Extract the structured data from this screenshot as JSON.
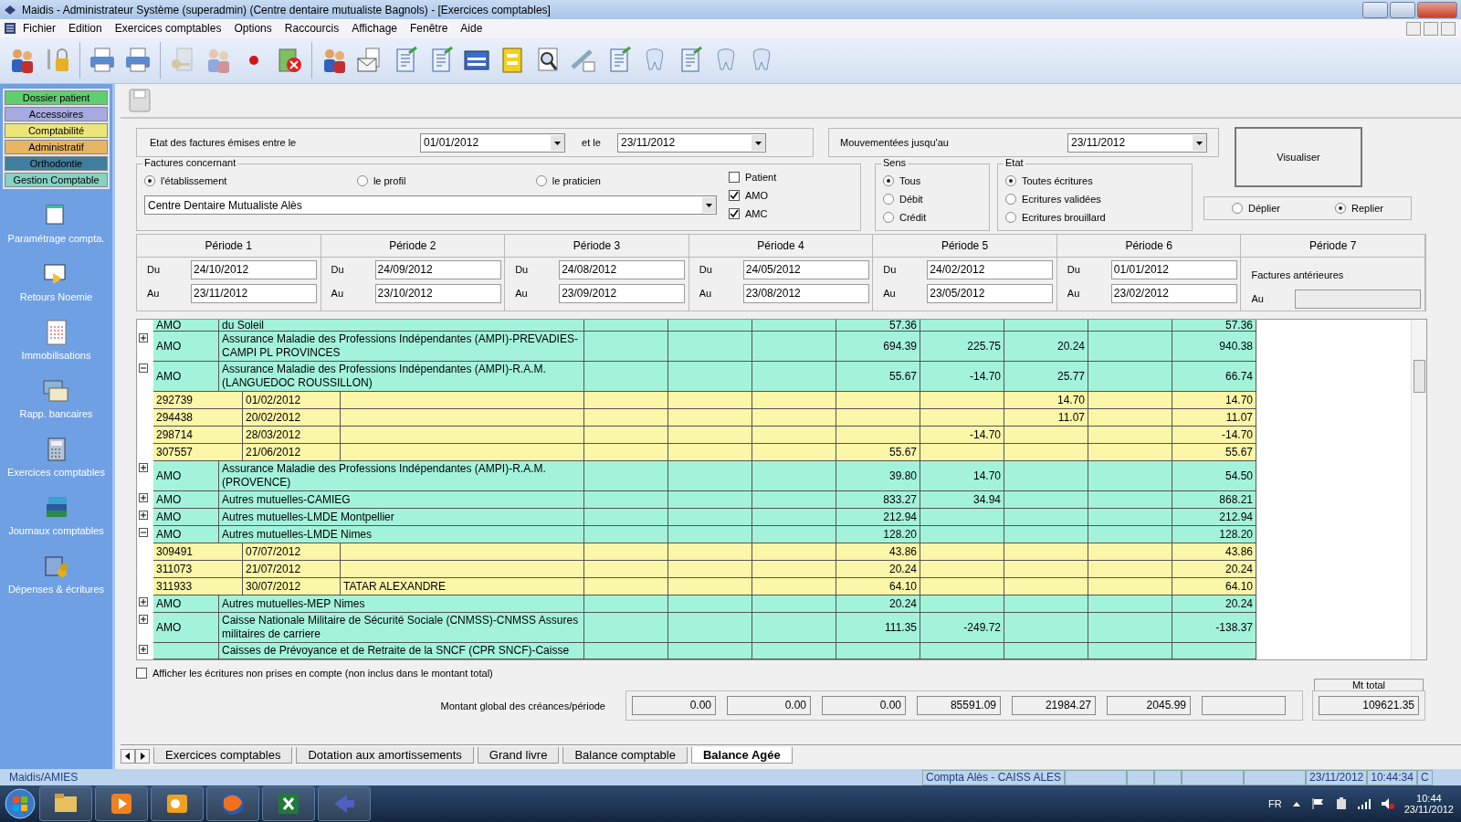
{
  "window": {
    "title": "Maidis - Administrateur Système (superadmin) (Centre dentaire mutualiste Bagnols) - [Exercices comptables]"
  },
  "menu": [
    "Fichier",
    "Edition",
    "Exercices comptables",
    "Options",
    "Raccourcis",
    "Affichage",
    "Fenêtre",
    "Aide"
  ],
  "toolbar": [
    {
      "disabled": false
    },
    {
      "disabled": false
    },
    {
      "disabled": false
    },
    {
      "disabled": false
    },
    {
      "disabled": true
    },
    {
      "disabled": true
    },
    {
      "disabled": false
    },
    {
      "disabled": false
    },
    {
      "disabled": false
    },
    {
      "disabled": false
    },
    {
      "disabled": false
    },
    {
      "disabled": false
    },
    {
      "disabled": false
    },
    {
      "disabled": false
    },
    {
      "disabled": false
    },
    {
      "disabled": false
    },
    {
      "disabled": false
    },
    {
      "disabled": false
    },
    {
      "disabled": false
    },
    {
      "disabled": false
    },
    {
      "disabled": false
    }
  ],
  "sidebar": {
    "categories": [
      {
        "label": "Dossier patient",
        "color": "#5fcf6f"
      },
      {
        "label": "Accessoires",
        "color": "#a7a9e3"
      },
      {
        "label": "Comptabilité",
        "color": "#ece57a"
      },
      {
        "label": "Administratif",
        "color": "#e8b565"
      },
      {
        "label": "Orthodontie",
        "color": "#3f7e9c"
      },
      {
        "label": "Gestion Comptable",
        "color": "#86d1c3"
      }
    ],
    "items": [
      "Paramétrage compta.",
      "Retours Noemie",
      "Immobilisations",
      "Rapp. bancaires",
      "Exercices comptables",
      "Journaux comptables",
      "Dépenses & écritures"
    ]
  },
  "filters": {
    "date_range": {
      "label": "Etat des factures émises entre le",
      "from": "01/01/2012",
      "to_label": "et le",
      "to": "23/11/2012"
    },
    "moved_until": {
      "label": "Mouvementées jusqu'au",
      "value": "23/11/2012"
    },
    "view_button": "Visualiser",
    "invoices_for": {
      "title": "Factures concernant",
      "options": [
        {
          "label": "l'établissement",
          "selected": true
        },
        {
          "label": "le profil",
          "selected": false
        },
        {
          "label": "le praticien",
          "selected": false
        }
      ],
      "value": "Centre Dentaire Mutualiste Alès"
    },
    "payers": [
      {
        "label": "Patient",
        "checked": false
      },
      {
        "label": "AMO",
        "checked": true
      },
      {
        "label": "AMC",
        "checked": true
      }
    ],
    "direction": {
      "title": "Sens",
      "options": [
        {
          "label": "Tous",
          "selected": true
        },
        {
          "label": "Débit",
          "selected": false
        },
        {
          "label": "Crédit",
          "selected": false
        }
      ]
    },
    "state": {
      "title": "Etat",
      "options": [
        {
          "label": "Toutes écritures",
          "selected": true
        },
        {
          "label": "Ecritures validées",
          "selected": false
        },
        {
          "label": "Ecritures brouillard",
          "selected": false
        }
      ]
    },
    "fold": [
      {
        "label": "Déplier",
        "selected": false
      },
      {
        "label": "Replier",
        "selected": true
      }
    ]
  },
  "periods": [
    {
      "kind": "dates",
      "title": "Période 1",
      "from_label": "Du",
      "from": "24/10/2012",
      "to_label": "Au",
      "to": "23/11/2012"
    },
    {
      "kind": "dates",
      "title": "Période 2",
      "from_label": "Du",
      "from": "24/09/2012",
      "to_label": "Au",
      "to": "23/10/2012"
    },
    {
      "kind": "dates",
      "title": "Période 3",
      "from_label": "Du",
      "from": "24/08/2012",
      "to_label": "Au",
      "to": "23/09/2012"
    },
    {
      "kind": "dates",
      "title": "Période 4",
      "from_label": "Du",
      "from": "24/05/2012",
      "to_label": "Au",
      "to": "23/08/2012"
    },
    {
      "kind": "dates",
      "title": "Période 5",
      "from_label": "Du",
      "from": "24/02/2012",
      "to_label": "Au",
      "to": "23/05/2012"
    },
    {
      "kind": "dates",
      "title": "Période 6",
      "from_label": "Du",
      "from": "01/01/2012",
      "to_label": "Au",
      "to": "23/02/2012"
    },
    {
      "kind": "older",
      "title": "Période 7",
      "note": "Factures antérieures",
      "to_label": "Au"
    }
  ],
  "table": {
    "rows": [
      {
        "kind": "cut_top",
        "code": "AMO",
        "name": "du Soleil",
        "values": {
          "p4": "57.36"
        },
        "total": "57.36"
      },
      {
        "kind": "group",
        "expanded": false,
        "code": "AMO",
        "name": "Assurance Maladie des Professions Indépendantes (AMPI)-PREVADIES-CAMPI PL PROVINCES",
        "values": {
          "p4": "694.39",
          "p5": "225.75",
          "p6": "20.24"
        },
        "total": "940.38"
      },
      {
        "kind": "group",
        "expanded": true,
        "code": "AMO",
        "name": "Assurance Maladie des Professions Indépendantes (AMPI)-R.A.M. (LANGUEDOC ROUSSILLON)",
        "values": {
          "p4": "55.67",
          "p5": "-14.70",
          "p6": "25.77"
        },
        "total": "66.74",
        "children": [
          {
            "invoice": "292739",
            "date": "01/02/2012",
            "values": {
              "p6": "14.70"
            },
            "total": "14.70"
          },
          {
            "invoice": "294438",
            "date": "20/02/2012",
            "values": {
              "p6": "11.07"
            },
            "total": "11.07"
          },
          {
            "invoice": "298714",
            "date": "28/03/2012",
            "values": {
              "p5": "-14.70"
            },
            "total": "-14.70"
          },
          {
            "invoice": "307557",
            "date": "21/06/2012",
            "values": {
              "p4": "55.67"
            },
            "total": "55.67"
          }
        ]
      },
      {
        "kind": "group",
        "expanded": false,
        "code": "AMO",
        "name": "Assurance Maladie des Professions Indépendantes (AMPI)-R.A.M. (PROVENCE)",
        "values": {
          "p4": "39.80",
          "p5": "14.70"
        },
        "total": "54.50"
      },
      {
        "kind": "group",
        "expanded": false,
        "code": "AMO",
        "name": "Autres mutuelles-CAMIEG",
        "values": {
          "p4": "833.27",
          "p5": "34.94"
        },
        "total": "868.21"
      },
      {
        "kind": "group",
        "expanded": false,
        "code": "AMO",
        "name": "Autres mutuelles-LMDE Montpellier",
        "values": {
          "p4": "212.94"
        },
        "total": "212.94"
      },
      {
        "kind": "group",
        "expanded": true,
        "code": "AMO",
        "name": "Autres mutuelles-LMDE Nimes",
        "values": {
          "p4": "128.20"
        },
        "total": "128.20",
        "children": [
          {
            "invoice": "309491",
            "date": "07/07/2012",
            "values": {
              "p4": "43.86"
            },
            "total": "43.86"
          },
          {
            "invoice": "311073",
            "date": "21/07/2012",
            "values": {
              "p4": "20.24"
            },
            "total": "20.24"
          },
          {
            "invoice": "311933",
            "date": "30/07/2012",
            "patient": "TATAR ALEXANDRE",
            "values": {
              "p4": "64.10"
            },
            "total": "64.10"
          }
        ]
      },
      {
        "kind": "group",
        "expanded": false,
        "code": "AMO",
        "name": "Autres mutuelles-MEP Nimes",
        "values": {
          "p4": "20.24"
        },
        "total": "20.24"
      },
      {
        "kind": "group",
        "expanded": false,
        "code": "AMO",
        "name": "Caisse Nationale Militaire de Sécurité Sociale (CNMSS)-CNMSS Assures militaires de carriere",
        "values": {
          "p4": "111.35",
          "p5": "-249.72"
        },
        "total": "-138.37"
      },
      {
        "kind": "cut_bottom",
        "expanded": false,
        "name": "Caisses de Prévoyance et de Retraite de la SNCF (CPR SNCF)-Caisse"
      }
    ]
  },
  "footer": {
    "option": {
      "label": "Afficher les écritures non prises en compte  (non inclus dans le montant total)",
      "checked": false
    },
    "totals_label": "Montant global des créances/période",
    "totals": [
      "0.00",
      "0.00",
      "0.00",
      "85591.09",
      "21984.27",
      "2045.99"
    ],
    "grand_total_label": "Mt total",
    "grand_total": "109621.35"
  },
  "tabs": [
    {
      "label": "Exercices comptables",
      "selected": false
    },
    {
      "label": "Dotation aux amortissements",
      "selected": false
    },
    {
      "label": "Grand livre",
      "selected": false
    },
    {
      "label": "Balance comptable",
      "selected": false
    },
    {
      "label": "Balance Agée",
      "selected": true
    }
  ],
  "status_bar": {
    "user": "Maidis/AMIES",
    "center": "Compta Alès - CAISS ALES",
    "date": "23/11/2012",
    "time": "10:44:34",
    "end": "C"
  },
  "taskbar": {
    "language": "FR",
    "time": "10:44",
    "date": "23/11/2012"
  }
}
